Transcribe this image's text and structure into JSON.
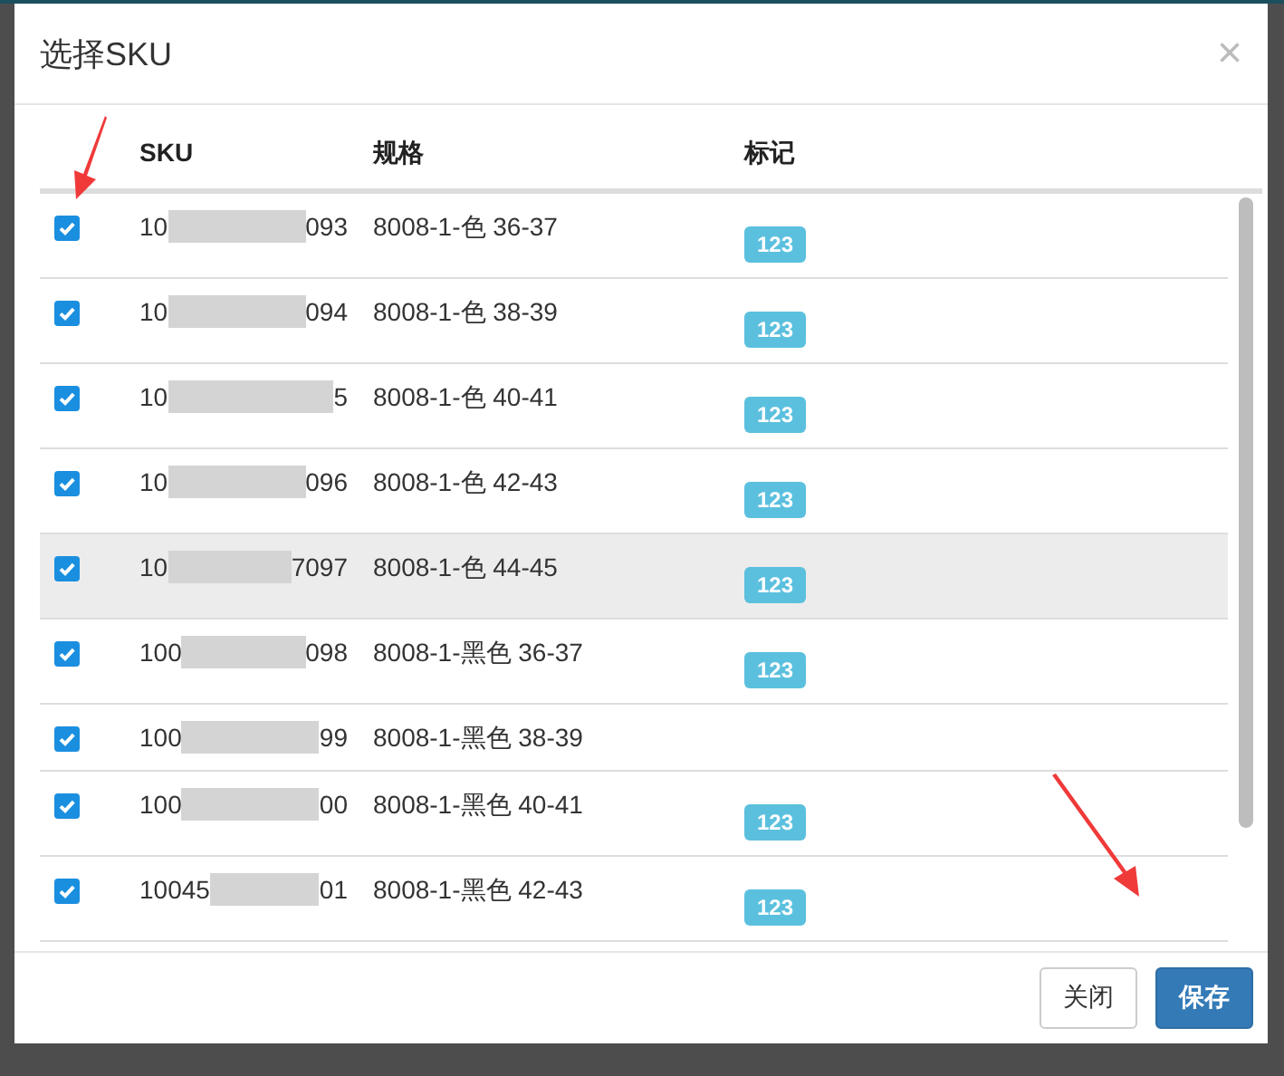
{
  "dialog": {
    "title": "选择SKU",
    "close": "×"
  },
  "table": {
    "columns": [
      "SKU",
      "规格",
      "标记"
    ],
    "rows": [
      {
        "checked": true,
        "sku_start": "10",
        "sku_end": "093",
        "spec": "8008-1-色 36-37",
        "tag": "123",
        "highlighted": false
      },
      {
        "checked": true,
        "sku_start": "10",
        "sku_end": "094",
        "spec": "8008-1-色 38-39",
        "tag": "123",
        "highlighted": false
      },
      {
        "checked": true,
        "sku_start": "10",
        "sku_end": "5",
        "spec": "8008-1-色 40-41",
        "tag": "123",
        "highlighted": false
      },
      {
        "checked": true,
        "sku_start": "10",
        "sku_end": "096",
        "spec": "8008-1-色 42-43",
        "tag": "123",
        "highlighted": false
      },
      {
        "checked": true,
        "sku_start": "10",
        "sku_end": "7097",
        "spec": "8008-1-色 44-45",
        "tag": "123",
        "highlighted": true
      },
      {
        "checked": true,
        "sku_start": "100",
        "sku_end": "098",
        "spec": "8008-1-黑色 36-37",
        "tag": "123",
        "highlighted": false
      },
      {
        "checked": true,
        "sku_start": "100",
        "sku_end": "99",
        "spec": "8008-1-黑色 38-39",
        "highlighted": false
      },
      {
        "checked": true,
        "sku_start": "100",
        "sku_end": "00",
        "spec": "8008-1-黑色 40-41",
        "tag": "123",
        "highlighted": false
      },
      {
        "checked": true,
        "sku_start": "10045",
        "sku_end": "01",
        "spec": "8008-1-黑色 42-43",
        "tag": "123",
        "highlighted": false
      }
    ]
  },
  "buttons": [
    {
      "label": "关闭",
      "kind": "default"
    },
    {
      "label": "保存",
      "kind": "primary"
    }
  ]
}
